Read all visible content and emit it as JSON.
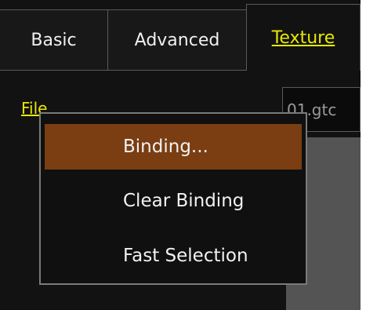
{
  "tabs": [
    {
      "label": "Basic"
    },
    {
      "label": "Advanced"
    },
    {
      "label": "Texture",
      "active": true
    }
  ],
  "file": {
    "label": "File",
    "value": "01.gtc"
  },
  "context_menu": {
    "items": [
      {
        "label": "Binding...",
        "highlighted": true
      },
      {
        "label": "Clear Binding"
      },
      {
        "label": "Fast Selection"
      }
    ]
  },
  "colors": {
    "background": "#121212",
    "accent_text": "#e8e800",
    "highlight": "#7a3e12",
    "border": "#5a5a5a",
    "preview": "#545454"
  }
}
